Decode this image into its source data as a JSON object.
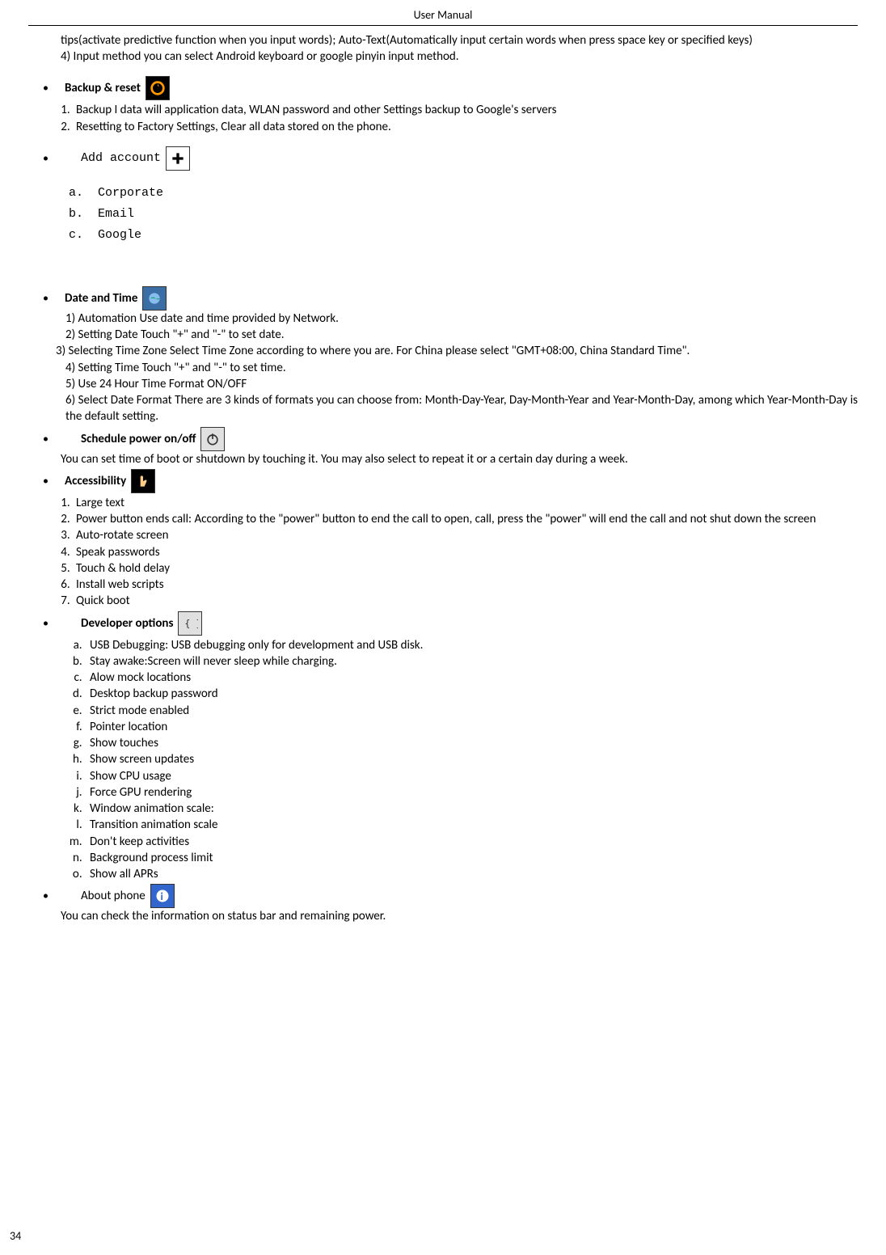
{
  "header": "User    Manual",
  "page_number": "34",
  "intro_line1": "tips(activate predictive function when you input words); Auto-Text(Automatically input certain words when press space key or specified keys)",
  "intro_line2": "4) Input method        you can select Android keyboard or google pinyin input method.",
  "backup": {
    "title": "Backup & reset",
    "items": [
      "Backup I data will application data, WLAN password and other Settings backup to Google's servers",
      "Resetting to Factory Settings, Clear all data stored on the phone."
    ]
  },
  "add_account": {
    "title": "Add account",
    "items": [
      {
        "letter": "a",
        "text": "Corporate"
      },
      {
        "letter": "b",
        "text": "Email"
      },
      {
        "letter": "c",
        "text": "Google"
      }
    ]
  },
  "date_time": {
    "title": "Date and Time",
    "items": [
      "1) Automation        Use date and time provided by Network.",
      "2) Setting Date        Touch \"+\" and \"-\" to set date.",
      "3) Selecting Time Zone      Select Time Zone according to where you are. For China please select \"GMT+08:00, China Standard Time\".",
      "4) Setting Time       Touch \"+\" and \"-\" to set time.",
      "5) Use 24 Hour Time Format        ON/OFF",
      "6) Select Date Format       There are 3 kinds of formats you can choose from: Month-Day-Year, Day-Month-Year and Year-Month-Day, among which Year-Month-Day is the default setting."
    ]
  },
  "schedule": {
    "title": "Schedule power on/off",
    "desc": "You can set time of boot or shutdown by touching it. You may also select to repeat it or a certain day during a week."
  },
  "accessibility": {
    "title": "Accessibility",
    "items": [
      "Large text",
      "Power button ends call: According to the \"power\" button to end the call to open, call, press the \"power\" will end the call and not shut down the screen",
      "Auto-rotate screen",
      "Speak passwords",
      "Touch & hold delay",
      "Install web scripts",
      "Quick boot"
    ]
  },
  "developer": {
    "title": "Developer    options",
    "items": [
      "USB Debugging: USB debugging only for development and USB disk.",
      "Stay awake:Screen will never sleep while charging.",
      "Alow mock locations",
      "Desktop backup password",
      "Strict mode enabled",
      "Pointer location",
      "Show touches",
      "Show screen updates",
      "Show   CPU usage",
      "Force GPU rendering",
      "Window animation scale:",
      "Transition animation scale",
      "Don't keep activities",
      "Background process limit",
      "Show all APRs"
    ]
  },
  "about": {
    "title": "About phone",
    "desc": "You can check the information on status bar and remaining power."
  }
}
